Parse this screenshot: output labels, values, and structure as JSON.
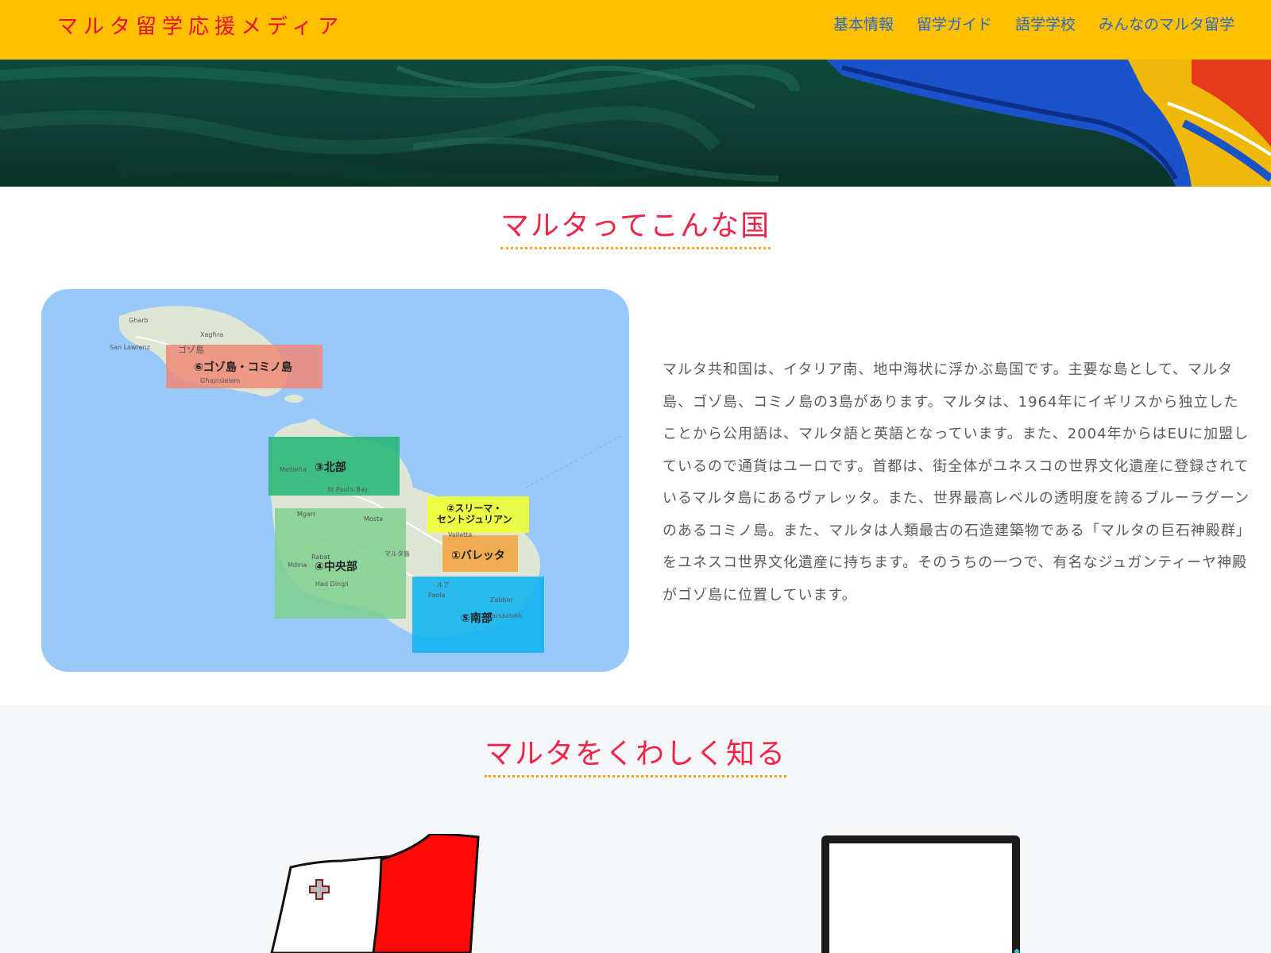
{
  "header": {
    "logo": "マルタ留学応援メディア",
    "nav": [
      "基本情報",
      "留学ガイド",
      "語学学校",
      "みんなのマルタ留学"
    ]
  },
  "section1": {
    "title": "マルタってこんな国",
    "description": "マルタ共和国は、イタリア南、地中海状に浮かぶ島国です。主要な島として、マルタ島、ゴゾ島、コミノ島の3島があります。マルタは、1964年にイギリスから独立したことから公用語は、マルタ語と英語となっています。また、2004年からはEUに加盟しているので通貨はユーロです。首都は、街全体がユネスコの世界文化遺産に登録されているマルタ島にあるヴァレッタ。また、世界最高レベルの透明度を誇るブルーラグーンのあるコミノ島。また、マルタは人類最古の石造建築物である「マルタの巨石神殿群」をユネスコ世界文化遺産に持ちます。そのうちの一つで、有名なジュガンティーヤ神殿がゴゾ島に位置しています。"
  },
  "map": {
    "regions": [
      {
        "label": "⑥ゴゾ島・コミノ島",
        "color": "#f08a78"
      },
      {
        "label": "③北部",
        "color": "#22b573"
      },
      {
        "label": "②スリーマ・\nセントジュリアン",
        "color": "#eeff33"
      },
      {
        "label": "①バレッタ",
        "color": "#f2a13c"
      },
      {
        "label": "④中央部",
        "color": "#7fcf8f"
      },
      {
        "label": "⑤南部",
        "color": "#14b4f0"
      }
    ],
    "place_names": [
      "Gharb",
      "Xagħra",
      "San Lawrenz",
      "ゴゾ島",
      "Għajnsielem",
      "Mellieħa",
      "St Paul's Bay",
      "Mgarr",
      "Mosta",
      "Rabat",
      "マルタ島",
      "Mdina",
      "Had Dingli",
      "Valletta",
      "ルア",
      "Marsaxlokk",
      "Paola",
      "Zabbar"
    ]
  },
  "section2": {
    "title": "マルタをくわしく知る"
  },
  "colors": {
    "header_bg": "#ffc000",
    "logo": "#ea0e34",
    "nav_link": "#2a67c7",
    "title": "#f0244a",
    "title_underline": "#f2a422"
  }
}
